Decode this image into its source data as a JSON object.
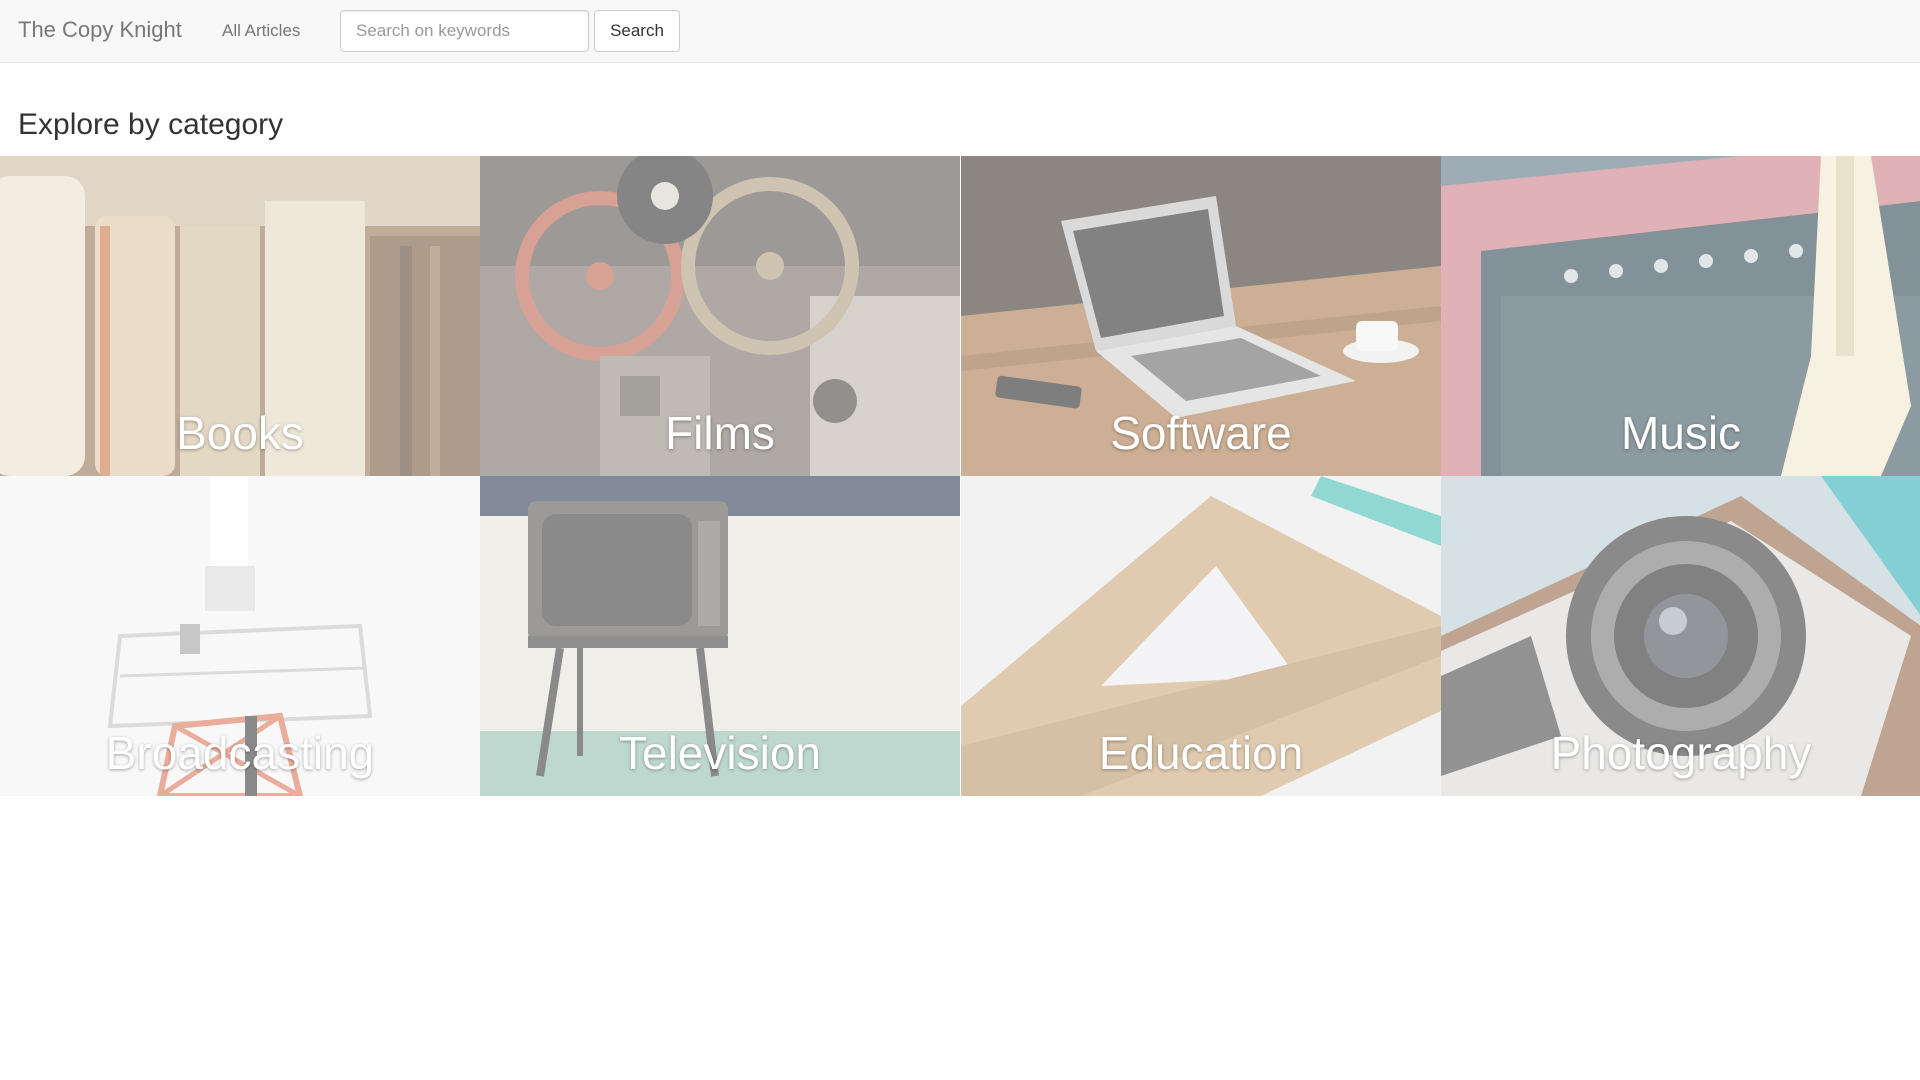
{
  "navbar": {
    "brand": "The Copy Knight",
    "links": [
      "All Articles"
    ],
    "search": {
      "placeholder": "Search on keywords",
      "value": "",
      "button_label": "Search"
    }
  },
  "main": {
    "heading": "Explore by category",
    "categories": [
      {
        "label": "Books",
        "image": "stack-of-old-books-photo"
      },
      {
        "label": "Films",
        "image": "film-reels-and-projector-photo"
      },
      {
        "label": "Software",
        "image": "laptop-on-wooden-desk-photo"
      },
      {
        "label": "Music",
        "image": "guitar-amplifier-photo"
      },
      {
        "label": "Broadcasting",
        "image": "radio-tower-photo"
      },
      {
        "label": "Television",
        "image": "vintage-television-photo"
      },
      {
        "label": "Education",
        "image": "wooden-set-square-photo"
      },
      {
        "label": "Photography",
        "image": "vintage-camera-lens-photo"
      }
    ]
  },
  "colors": {
    "navbar_background": "#f8f8f8",
    "navbar_text": "#777777",
    "heading_text": "#333333",
    "tile_label": "#ffffff"
  }
}
